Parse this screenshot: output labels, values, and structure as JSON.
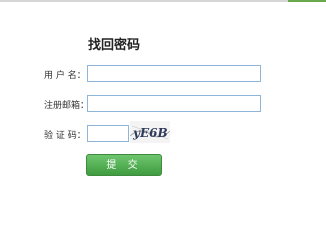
{
  "title": "找回密码",
  "form": {
    "username_label": "用 户 名：",
    "email_label": "注册邮箱：",
    "captcha_label": "验 证 码：",
    "username_value": "",
    "email_value": "",
    "captcha_value": "",
    "captcha_image_text": "yE6B",
    "submit_label": "提 交"
  },
  "colors": {
    "input_border": "#8fb5d9",
    "button_green": "#4aa84a",
    "top_accent": "#6aa84f"
  }
}
